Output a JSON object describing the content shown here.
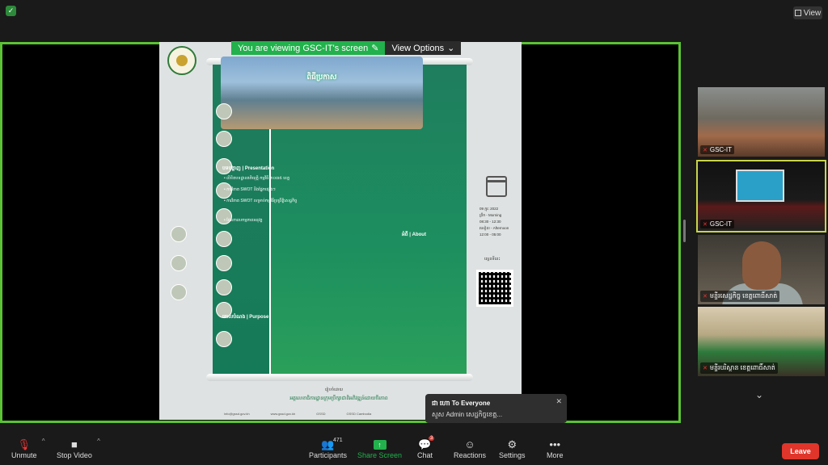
{
  "top": {
    "view_label": "View"
  },
  "share_banner": {
    "message": "You are viewing GSC-IT's screen",
    "options_label": "View Options"
  },
  "poster": {
    "title_line": "ពិធីប្រកាស",
    "section_presentation": "បទបង្ហាញ | Presentation",
    "bullets": [
      "• លិខិតបទដ្ឋានគតិយុត្តិ កម្មវិធី ២០៣៥ ខេត្ត",
      "• ការវិភាគ SWOT និងផ្នែកផ្សេងៗ",
      "• ការវិភាគ SWOT សម្រាប់កម្មវិធីប្រព្រឹត្តិសេដ្ឋកិច្ច",
      "• ផែនការសកម្មភាពអនុវត្ត"
    ],
    "section_about": "អំពី | About",
    "section_purpose": "គោលបំណង | Purpose",
    "date_line": "09 ក្មុរៈ 2022",
    "morning_label": "ព្រឹក - Morning",
    "morning_time": "08:30 - 12:30",
    "afternoon_label": "រសៀល - Afternoon",
    "afternoon_time": "12:00 - 05:00",
    "qr_label": "ស្កេនទីនេះ",
    "org_label": "រៀបចំដោយ",
    "org_line": "អគ្គលេខាធិការដ្ឋានក្រុមប្រឹក្សាជាតិអភិវឌ្ឍន៍ដោយចីរភាព",
    "contacts": [
      "info@gssd.gov.kh",
      "www.gssd.gov.kh",
      "GSSD",
      "GSSD Cambodia"
    ]
  },
  "participants": [
    {
      "name": "GSC-IT"
    },
    {
      "name": "GSC-IT"
    },
    {
      "name": "មន្ទីរសេដ្ឋកិច្ច ខេត្តពោធិ៍សាត់"
    },
    {
      "name": "មន្ទីរបរិស្ថាន ខេត្តពោធិ៍សាត់"
    }
  ],
  "chat": {
    "sender": "ជា ហោ To Everyone",
    "text": "សួស Admin សេដ្ឋកិច្ចខេត្ត..."
  },
  "toolbar": {
    "unmute": "Unmute",
    "stop_video": "Stop Video",
    "participants": "Participants",
    "participants_count": "471",
    "share_screen": "Share Screen",
    "chat": "Chat",
    "chat_badge": "3",
    "reactions": "Reactions",
    "settings": "Settings",
    "more": "More",
    "leave": "Leave"
  },
  "colors": {
    "accent_green": "#22b14c",
    "frame_green": "#5bc236",
    "leave_red": "#e0352b"
  }
}
